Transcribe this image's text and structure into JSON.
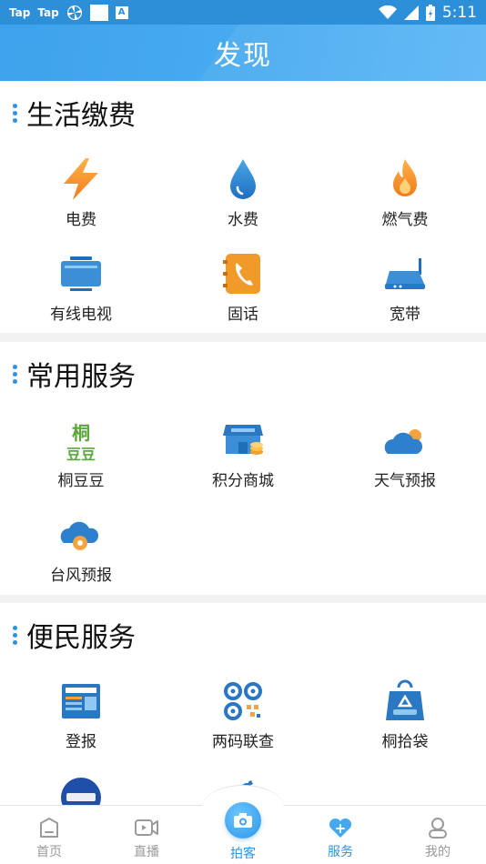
{
  "status_bar": {
    "left_labels": [
      "Tap",
      "Tap"
    ],
    "time": "5:11"
  },
  "header": {
    "title": "发现"
  },
  "sections": [
    {
      "title": "生活缴费",
      "items": [
        {
          "label": "电费",
          "icon": "lightning-icon"
        },
        {
          "label": "水费",
          "icon": "water-drop-icon"
        },
        {
          "label": "燃气费",
          "icon": "flame-icon"
        },
        {
          "label": "有线电视",
          "icon": "tv-icon"
        },
        {
          "label": "固话",
          "icon": "phone-icon"
        },
        {
          "label": "宽带",
          "icon": "router-icon"
        }
      ]
    },
    {
      "title": "常用服务",
      "items": [
        {
          "label": "桐豆豆",
          "icon": "tongdoudou-logo-icon"
        },
        {
          "label": "积分商城",
          "icon": "shop-icon"
        },
        {
          "label": "天气预报",
          "icon": "weather-cloud-icon"
        },
        {
          "label": "台风预报",
          "icon": "typhoon-icon"
        }
      ]
    },
    {
      "title": "便民服务",
      "items": [
        {
          "label": "登报",
          "icon": "newspaper-icon"
        },
        {
          "label": "两码联查",
          "icon": "qr-code-icon"
        },
        {
          "label": "桐拾袋",
          "icon": "recycle-bag-icon"
        }
      ]
    }
  ],
  "tabbar": {
    "tabs": [
      {
        "label": "首页",
        "icon": "home-icon"
      },
      {
        "label": "直播",
        "icon": "live-video-icon"
      },
      {
        "label": "拍客",
        "icon": "camera-icon"
      },
      {
        "label": "服务",
        "icon": "service-heart-icon"
      },
      {
        "label": "我的",
        "icon": "profile-icon"
      }
    ],
    "active": "服务"
  },
  "colors": {
    "accent": "#2d92e3",
    "header": "#47aaf0",
    "text": "#222222",
    "tab_inactive": "#9a9a9a"
  }
}
